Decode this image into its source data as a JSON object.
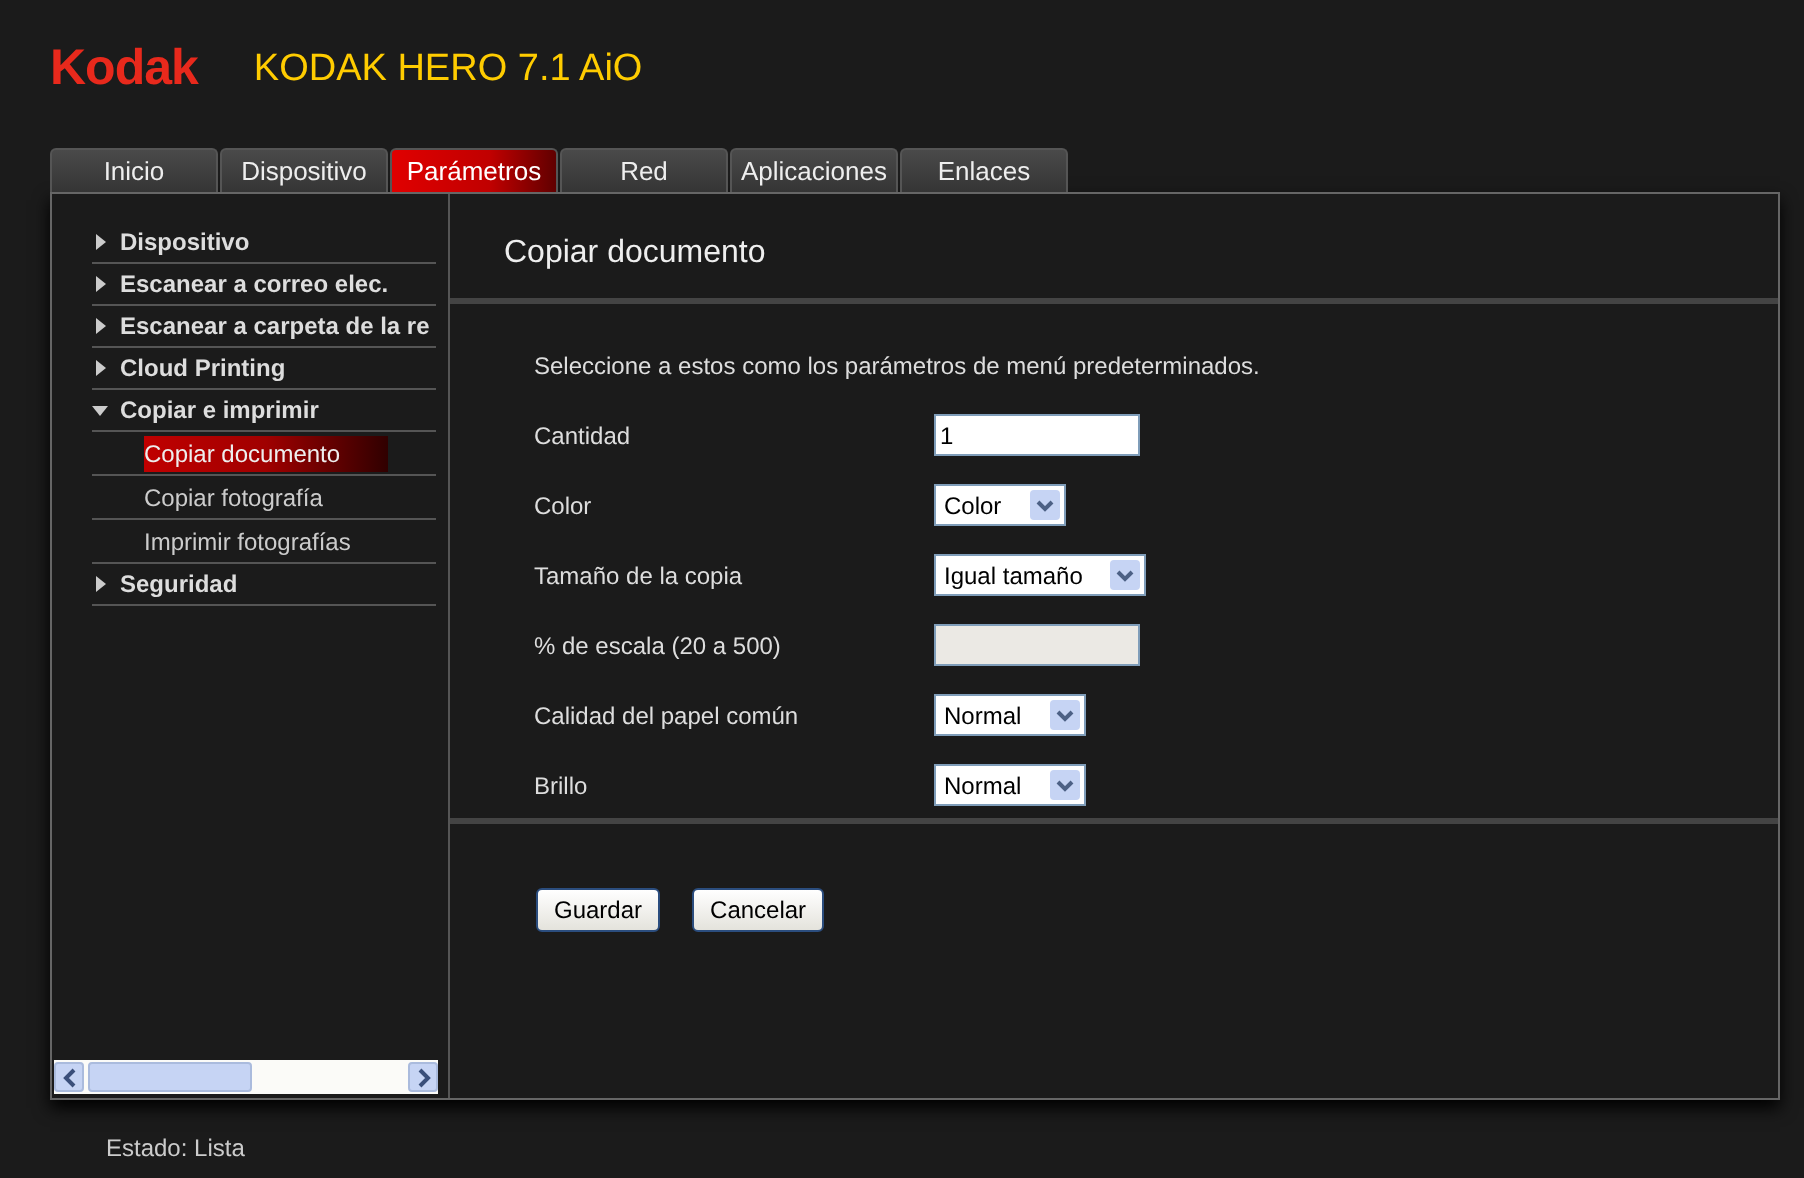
{
  "header": {
    "logo": "Kodak",
    "title": "KODAK HERO 7.1 AiO"
  },
  "tabs": [
    {
      "label": "Inicio",
      "selected": false
    },
    {
      "label": "Dispositivo",
      "selected": false
    },
    {
      "label": "Parámetros",
      "selected": true
    },
    {
      "label": "Red",
      "selected": false
    },
    {
      "label": "Aplicaciones",
      "selected": false
    },
    {
      "label": "Enlaces",
      "selected": false
    }
  ],
  "sidebar": {
    "items": [
      {
        "label": "Dispositivo",
        "expanded": false
      },
      {
        "label": "Escanear a correo elec.",
        "expanded": false
      },
      {
        "label": "Escanear a carpeta de la re",
        "expanded": false
      },
      {
        "label": "Cloud Printing",
        "expanded": false
      },
      {
        "label": "Copiar e imprimir",
        "expanded": true,
        "children": [
          {
            "label": "Copiar documento",
            "selected": true
          },
          {
            "label": "Copiar fotografía",
            "selected": false
          },
          {
            "label": "Imprimir fotografías",
            "selected": false
          }
        ]
      },
      {
        "label": "Seguridad",
        "expanded": false
      }
    ]
  },
  "content": {
    "title": "Copiar documento",
    "intro": "Seleccione a estos como los parámetros de menú predeterminados.",
    "fields": [
      {
        "kind": "text",
        "label": "Cantidad",
        "value": "1",
        "disabled": false
      },
      {
        "kind": "select",
        "label": "Color",
        "value": "Color",
        "disabled": false
      },
      {
        "kind": "select",
        "label": "Tamaño de la copia",
        "value": "Igual tamaño",
        "disabled": false
      },
      {
        "kind": "text",
        "label": "% de escala (20 a 500)",
        "disabled": true
      },
      {
        "kind": "select",
        "label": "Calidad del papel común",
        "value": "Normal",
        "disabled": false
      },
      {
        "kind": "select",
        "label": "Brillo",
        "value": "Normal",
        "disabled": false
      }
    ],
    "buttons": [
      "Guardar",
      "Cancelar"
    ]
  },
  "status_bar": "Estado: Lista"
}
